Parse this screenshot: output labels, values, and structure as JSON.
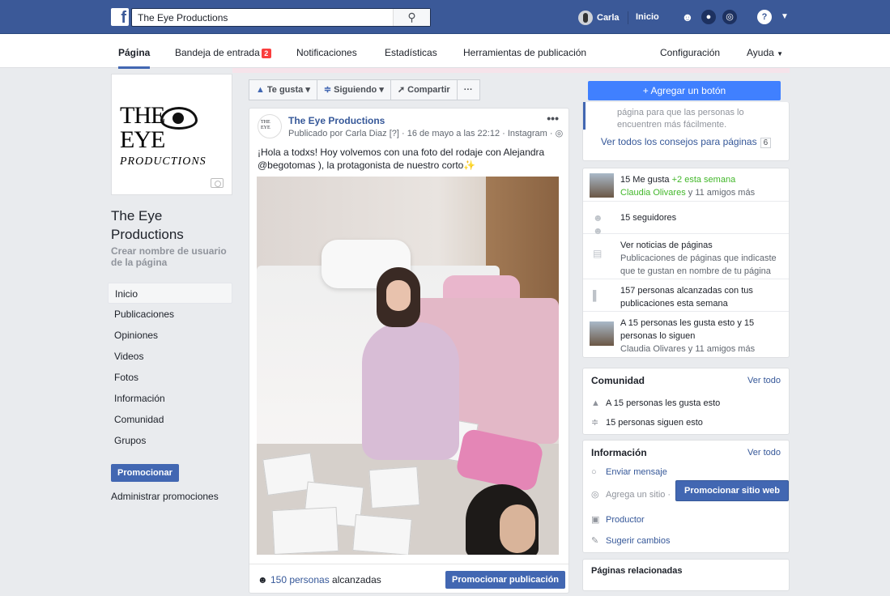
{
  "topbar": {
    "search_value": "The Eye Productions",
    "user_name": "Carla",
    "home_label": "Inicio"
  },
  "subnav": {
    "tab_pagina": "Página",
    "tab_bandeja": "Bandeja de entrada",
    "bandeja_badge": "2",
    "tab_notificaciones": "Notificaciones",
    "tab_estadisticas": "Estadísticas",
    "tab_herramientas": "Herramientas de publicación",
    "configuracion": "Configuración",
    "ayuda": "Ayuda"
  },
  "left": {
    "logo_line1": "THE",
    "logo_line2": "EYE",
    "logo_line3": "PRODUCTIONS",
    "page_name": "The Eye Productions",
    "username_link": "Crear nombre de usuario de la página",
    "nav": [
      "Inicio",
      "Publicaciones",
      "Opiniones",
      "Videos",
      "Fotos",
      "Información",
      "Comunidad",
      "Grupos"
    ],
    "promote_button": "Promocionar",
    "manage_promotions": "Administrar promociones"
  },
  "actions": {
    "like": "Te gusta",
    "follow": "Siguiendo",
    "share": "Compartir",
    "more": "···",
    "add_button": "+ Agregar un botón"
  },
  "post": {
    "author": "The Eye Productions",
    "meta": "Publicado por Carla Diaz [?] · 16 de mayo a las 22:12 · Instagram · ",
    "text": "¡Hola a todxs! Hoy volvemos con una foto del rodaje con Alejandra @begotomas ), la protagonista de nuestro corto",
    "reach_count": "150 personas",
    "reach_suffix": " alcanzadas",
    "promote_post": "Promocionar publicación"
  },
  "tips": {
    "text": "página para que las personas lo encuentren más fácilmente.",
    "link": "Ver todos los consejos para páginas",
    "count": "6"
  },
  "stats": {
    "likes": "15 Me gusta",
    "likes_week": "+2 esta semana",
    "likes_friends": "Claudia Olivares",
    "likes_friends_suffix": " y 11 amigos más",
    "followers": "15 seguidores",
    "news_title": "Ver noticias de páginas",
    "news_sub": "Publicaciones de páginas que indicaste que te gustan en nombre de tu página",
    "reach_line": "157 personas alcanzadas con tus publicaciones esta semana",
    "like_follow": "A 15 personas les gusta esto y 15 personas lo siguen",
    "like_follow_sub": "Claudia Olivares y 11 amigos más"
  },
  "community": {
    "title": "Comunidad",
    "see_all": "Ver todo",
    "likes": "A 15 personas les gusta esto",
    "follows": "15 personas siguen esto"
  },
  "info": {
    "title": "Información",
    "see_all": "Ver todo",
    "message": "Enviar mensaje",
    "add_site": "Agrega un sitio ·",
    "promote_web": "Promocionar sitio web",
    "category": "Productor",
    "suggest": "Sugerir cambios"
  },
  "related": {
    "title": "Páginas relacionadas"
  }
}
